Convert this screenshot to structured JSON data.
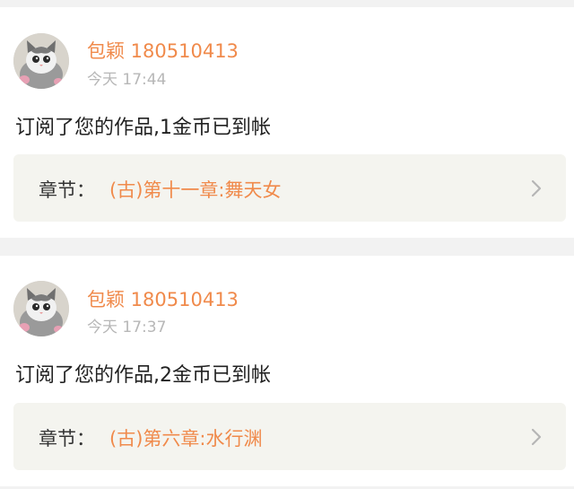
{
  "notifications": [
    {
      "user_name": "包颖 180510413",
      "time": "今天 17:44",
      "message": "订阅了您的作品,1金币已到帐",
      "chapter_label": "章节：",
      "chapter_title": "(古)第十一章:舞天女",
      "avatar_icon": "cat-avatar-icon",
      "chevron_icon": "chevron-right-icon"
    },
    {
      "user_name": "包颖 180510413",
      "time": "今天 17:37",
      "message": "订阅了您的作品,2金币已到帐",
      "chapter_label": "章节：",
      "chapter_title": "(古)第六章:水行渊",
      "avatar_icon": "cat-avatar-icon",
      "chevron_icon": "chevron-right-icon"
    }
  ],
  "colors": {
    "accent": "#f08a4b",
    "timestamp": "#b7b7b7",
    "text": "#222222",
    "chapter_bg": "#f4f4ef",
    "page_bg": "#f2f2f2"
  }
}
